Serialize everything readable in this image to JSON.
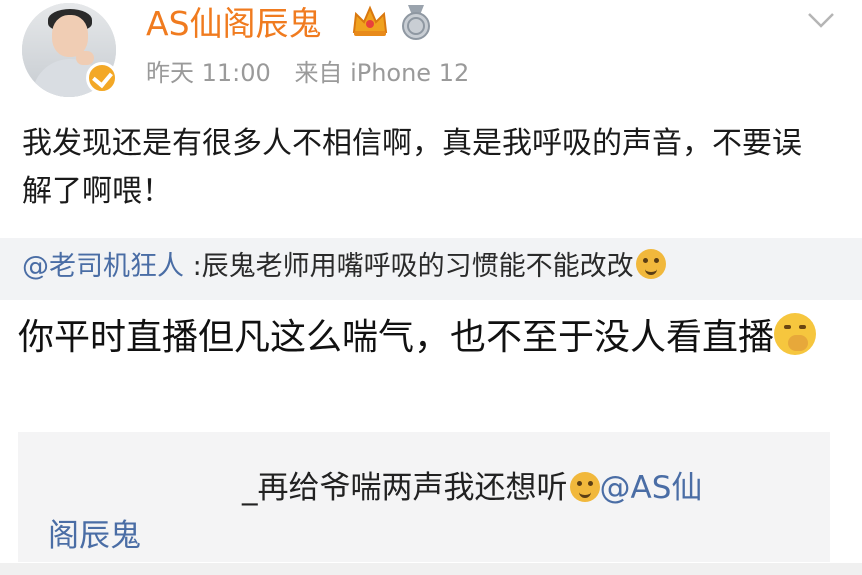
{
  "post": {
    "author": "AS仙阁辰鬼",
    "timestamp": "昨天 11:00",
    "source": "来自 iPhone 12",
    "text": "我发现还是有很多人不相信啊，真是我呼吸的声音，不要误解了啊喂！"
  },
  "repost": {
    "mention": "@老司机狂人",
    "text": " :辰鬼老师用嘴呼吸的习惯能不能改改"
  },
  "comment": {
    "text": "你平时直播但凡这么喘气，也不至于没人看直播"
  },
  "reply": {
    "prefix": "_",
    "text": "再给爷喘两声我还想听",
    "mention_part1": "@AS仙",
    "mention_part2": "阁辰鬼"
  },
  "icons": {
    "verified": "verified-badge-icon",
    "crown": "crown-icon",
    "medal": "medal-icon",
    "more": "chevron-down-icon",
    "dog_emoji": "doge-emoji-icon",
    "shush_emoji": "shush-emoji-icon"
  },
  "colors": {
    "username": "#f07b1f",
    "mention": "#4a6da5",
    "meta": "#9a9a9a",
    "verified": "#f3a826",
    "quote_bg": "#f2f3f5"
  }
}
